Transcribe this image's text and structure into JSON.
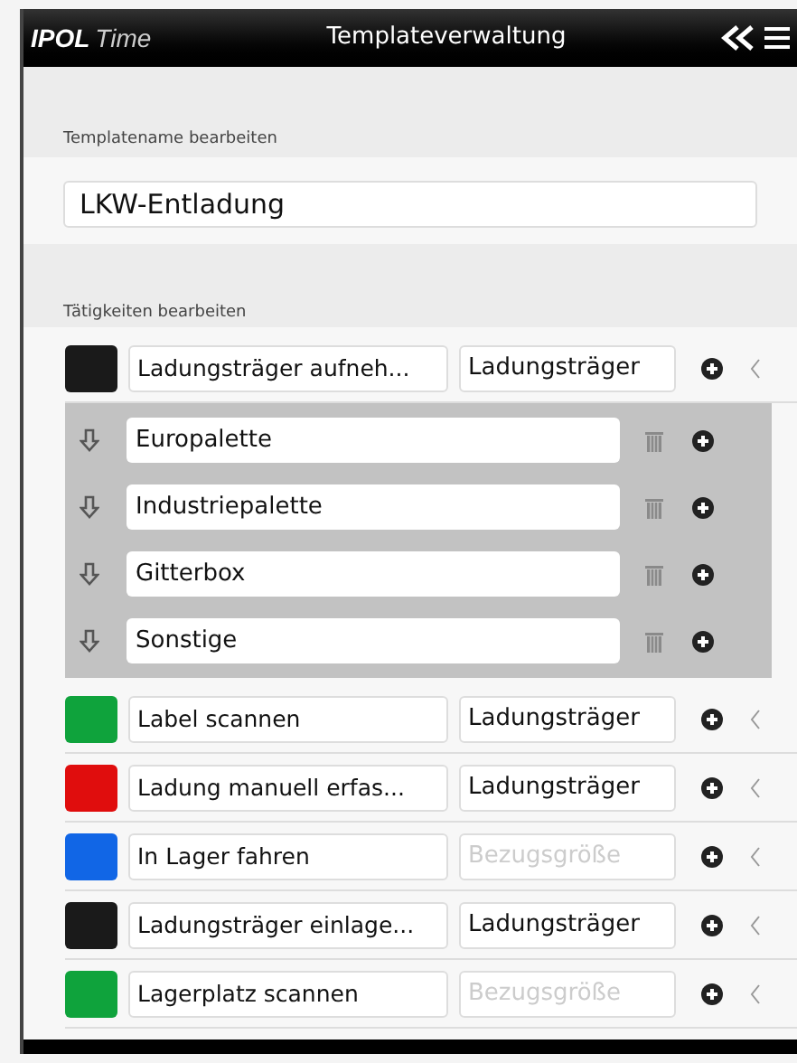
{
  "header": {
    "logo_brand": "IPOL",
    "logo_suffix": "Time",
    "title": "Templateverwaltung"
  },
  "template_section": {
    "label": "Templatename bearbeiten",
    "name_value": "LKW-Entladung"
  },
  "activities_section": {
    "label": "Tätigkeiten bearbeiten",
    "activities": [
      {
        "color": "#1a1a1a",
        "name": "Ladungsträger aufneh...",
        "reference": "Ladungsträger",
        "children": [
          {
            "name": "Europalette"
          },
          {
            "name": "Industriepalette"
          },
          {
            "name": "Gitterbox"
          },
          {
            "name": "Sonstige"
          }
        ]
      },
      {
        "color": "#0fa33c",
        "name": "Label scannen",
        "reference": "Ladungsträger"
      },
      {
        "color": "#e00d0d",
        "name": "Ladung manuell erfas...",
        "reference": "Ladungsträger"
      },
      {
        "color": "#1166e6",
        "name": "In Lager fahren",
        "reference_placeholder": "Bezugsgröße"
      },
      {
        "color": "#1a1a1a",
        "name": "Ladungsträger einlage...",
        "reference": "Ladungsträger"
      },
      {
        "color": "#0fa33c",
        "name": "Lagerplatz scannen",
        "reference_placeholder": "Bezugsgröße"
      }
    ]
  }
}
